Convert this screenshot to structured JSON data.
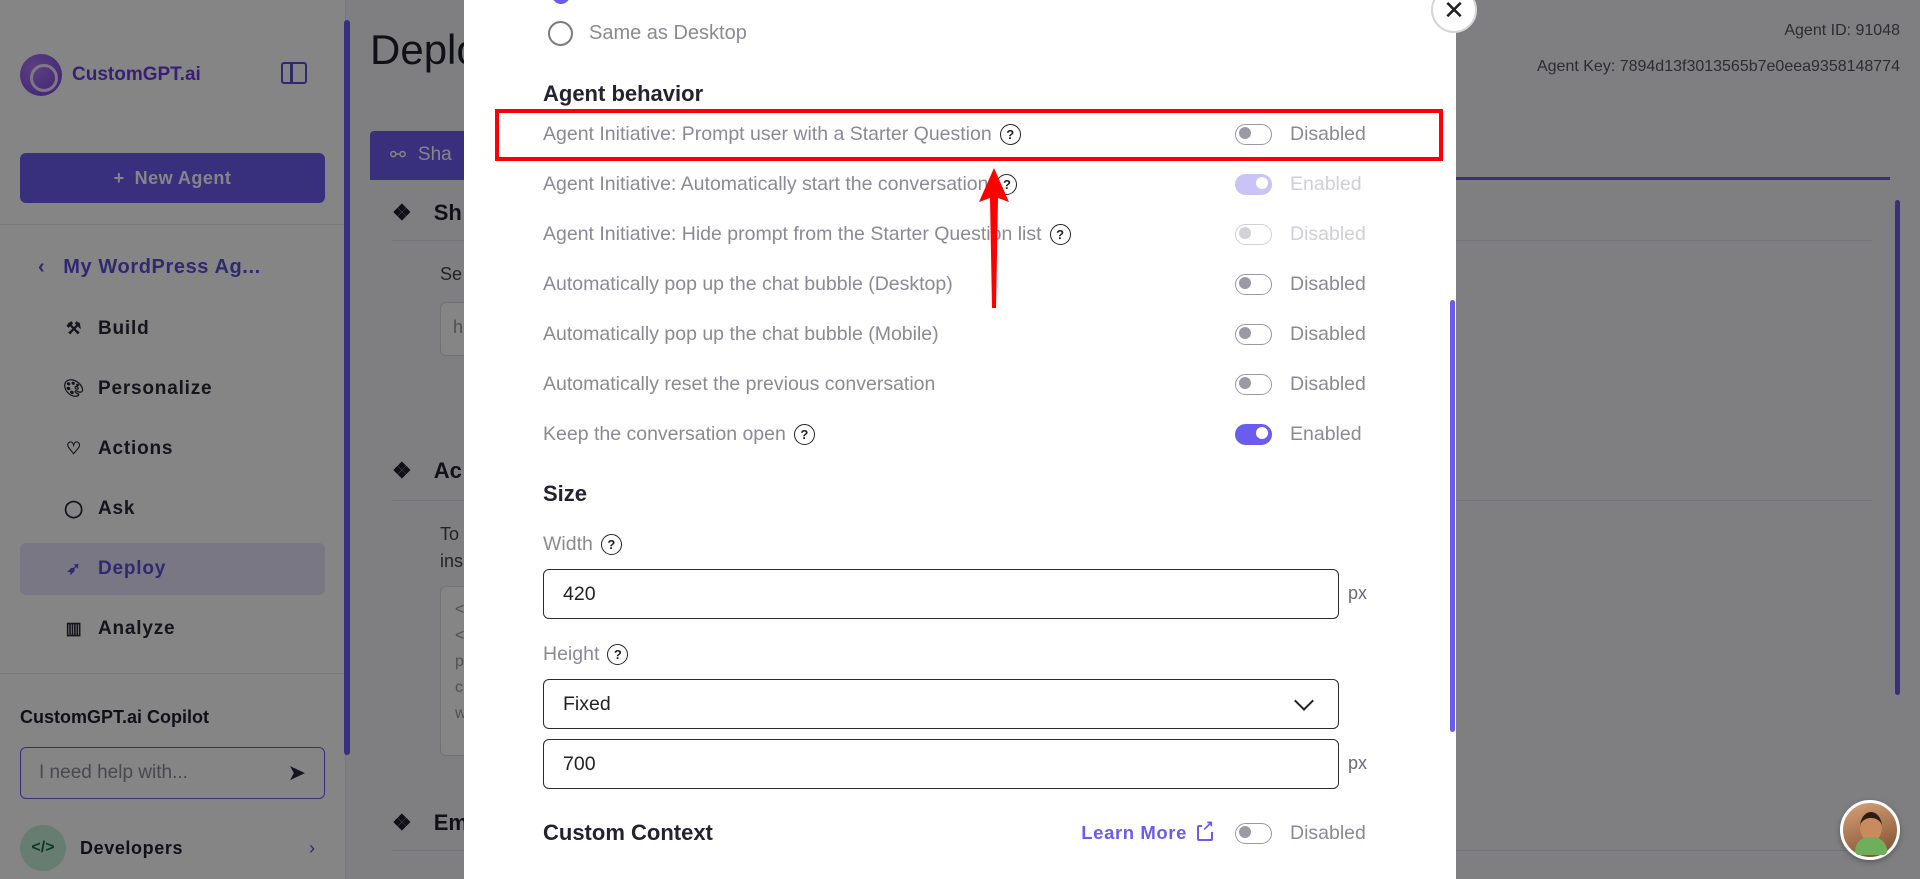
{
  "sidebar": {
    "brand": "CustomGPT.ai",
    "new_agent_label": "New Agent",
    "agent_name": "My WordPress Ag...",
    "items": [
      {
        "label": "Build",
        "icon": "build-icon"
      },
      {
        "label": "Personalize",
        "icon": "palette-icon"
      },
      {
        "label": "Actions",
        "icon": "heart-icon"
      },
      {
        "label": "Ask",
        "icon": "chat-icon"
      },
      {
        "label": "Deploy",
        "icon": "rocket-icon",
        "active": true
      },
      {
        "label": "Analyze",
        "icon": "chart-icon"
      }
    ],
    "copilot_title": "CustomGPT.ai Copilot",
    "copilot_placeholder": "I need help with...",
    "developers_label": "Developers"
  },
  "main": {
    "page_title": "Deplo",
    "agent_id": "Agent ID: 91048",
    "agent_key": "Agent Key: 7894d13f3013565b7e0eea9358148774",
    "share_tab_label": "Sha",
    "sections": [
      {
        "label": "Sh",
        "sub": "Se",
        "input_hint": "h"
      },
      {
        "label": "Ac",
        "sub_line1": "To",
        "sub_line2": "ins",
        "code_lines": [
          "<",
          "<",
          "p",
          "c",
          "w"
        ]
      },
      {
        "label": "Em"
      }
    ]
  },
  "modal": {
    "radio_same_as_desktop": "Same as Desktop",
    "agent_behavior_heading": "Agent behavior",
    "settings": [
      {
        "label": "Agent Initiative: Prompt user with a Starter Question",
        "help": true,
        "on": false,
        "status": "Disabled",
        "faded": false
      },
      {
        "label": "Agent Initiative: Automatically start the conversation",
        "help": true,
        "on": true,
        "status": "Enabled",
        "faded": true
      },
      {
        "label": "Agent Initiative: Hide prompt from the Starter Question list",
        "help": true,
        "on": false,
        "status": "Disabled",
        "faded": true
      },
      {
        "label": "Automatically pop up the chat bubble (Desktop)",
        "help": false,
        "on": false,
        "status": "Disabled",
        "faded": false
      },
      {
        "label": "Automatically pop up the chat bubble (Mobile)",
        "help": false,
        "on": false,
        "status": "Disabled",
        "faded": false
      },
      {
        "label": "Automatically reset the previous conversation",
        "help": false,
        "on": false,
        "status": "Disabled",
        "faded": false
      },
      {
        "label": "Keep the conversation open",
        "help": true,
        "on": true,
        "status": "Enabled",
        "faded": false
      }
    ],
    "size_heading": "Size",
    "width_label": "Width",
    "width_value": "420",
    "unit": "px",
    "height_label": "Height",
    "height_mode": "Fixed",
    "height_value": "700",
    "custom_context_heading": "Custom Context",
    "learn_more": "Learn More",
    "custom_context_status": "Disabled"
  },
  "colors": {
    "accent": "#6b5cf0",
    "annotation": "#ff0000",
    "overlay": "rgba(0,0,0,0.48)"
  }
}
